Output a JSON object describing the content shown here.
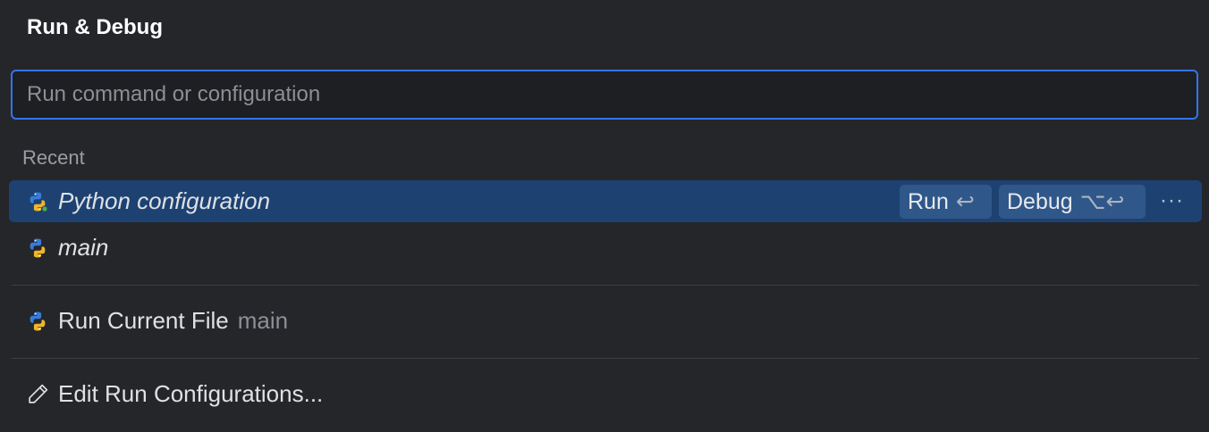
{
  "header": {
    "title": "Run & Debug"
  },
  "search": {
    "placeholder": "Run command or configuration",
    "value": ""
  },
  "recent": {
    "label": "Recent",
    "items": [
      {
        "label": "Python configuration",
        "icon": "python-icon",
        "selected": true,
        "run_label": "Run",
        "run_shortcut": "↩",
        "debug_label": "Debug",
        "debug_shortcut": "⌥↩",
        "more_label": "···"
      },
      {
        "label": "main",
        "icon": "python-icon",
        "selected": false
      }
    ]
  },
  "run_current": {
    "label": "Run Current File",
    "sub": "main",
    "icon": "python-icon"
  },
  "edit_configs": {
    "label": "Edit Run Configurations...",
    "icon": "pencil-icon"
  },
  "colors": {
    "background": "#25262a",
    "accent": "#3574f0",
    "selection": "#1d4272",
    "python_blue": "#3a7bd5",
    "python_yellow": "#f0b429",
    "status_green": "#4caf50"
  }
}
